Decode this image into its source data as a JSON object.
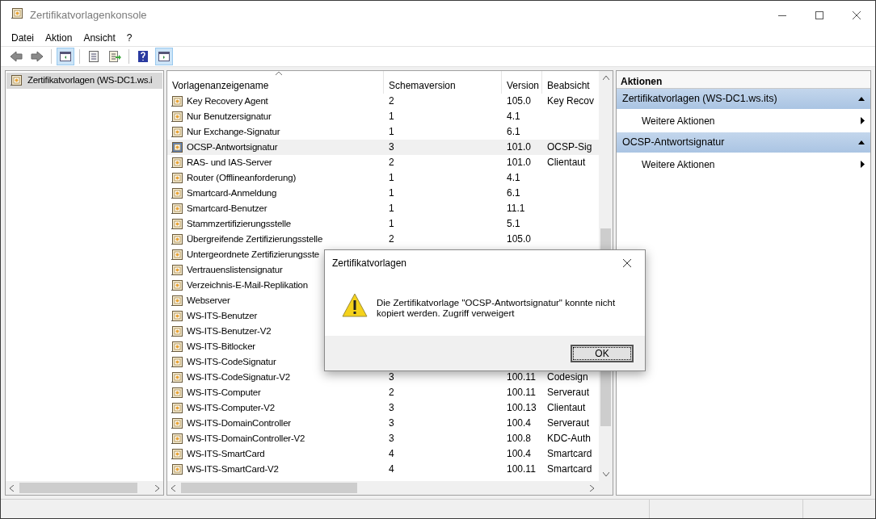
{
  "window": {
    "title": "Zertifikatvorlagenkonsole"
  },
  "menu": [
    "Datei",
    "Aktion",
    "Ansicht",
    "?"
  ],
  "tree": {
    "items": [
      {
        "label": "Zertifikatvorlagen (WS-DC1.ws.i",
        "selected": true
      }
    ]
  },
  "table": {
    "columns": [
      "Vorlagenanzeigename",
      "Schemaversion",
      "Version",
      "Beabsicht"
    ],
    "rows": [
      {
        "name": "Key Recovery Agent",
        "schema": "2",
        "version": "105.0",
        "purpose": "Key Recov",
        "selected": false
      },
      {
        "name": "Nur Benutzersignatur",
        "schema": "1",
        "version": "4.1",
        "selected": false
      },
      {
        "name": "Nur Exchange-Signatur",
        "schema": "1",
        "version": "6.1",
        "selected": false
      },
      {
        "name": "OCSP-Antwortsignatur",
        "schema": "3",
        "version": "101.0",
        "purpose": "OCSP-Sig",
        "selected": true
      },
      {
        "name": "RAS- und IAS-Server",
        "schema": "2",
        "version": "101.0",
        "purpose": "Clientaut",
        "selected": false
      },
      {
        "name": "Router (Offlineanforderung)",
        "schema": "1",
        "version": "4.1",
        "selected": false
      },
      {
        "name": "Smartcard-Anmeldung",
        "schema": "1",
        "version": "6.1",
        "selected": false
      },
      {
        "name": "Smartcard-Benutzer",
        "schema": "1",
        "version": "11.1",
        "selected": false
      },
      {
        "name": "Stammzertifizierungsstelle",
        "schema": "1",
        "version": "5.1",
        "selected": false
      },
      {
        "name": "Übergreifende Zertifizierungsstelle",
        "schema": "2",
        "version": "105.0",
        "selected": false
      },
      {
        "name": "Untergeordnete Zertifizierungsste",
        "selected": false
      },
      {
        "name": "Vertrauenslistensignatur",
        "selected": false
      },
      {
        "name": "Verzeichnis-E-Mail-Replikation",
        "selected": false
      },
      {
        "name": "Webserver",
        "selected": false
      },
      {
        "name": "WS-ITS-Benutzer",
        "selected": false
      },
      {
        "name": "WS-ITS-Benutzer-V2",
        "selected": false
      },
      {
        "name": "WS-ITS-Bitlocker",
        "selected": false
      },
      {
        "name": "WS-ITS-CodeSignatur",
        "selected": false
      },
      {
        "name": "WS-ITS-CodeSignatur-V2",
        "schema": "3",
        "version": "100.11",
        "purpose": "Codesign",
        "selected": false
      },
      {
        "name": "WS-ITS-Computer",
        "schema": "2",
        "version": "100.11",
        "purpose": "Serveraut",
        "selected": false
      },
      {
        "name": "WS-ITS-Computer-V2",
        "schema": "3",
        "version": "100.13",
        "purpose": "Clientaut",
        "selected": false
      },
      {
        "name": "WS-ITS-DomainController",
        "schema": "3",
        "version": "100.4",
        "purpose": "Serveraut",
        "selected": false
      },
      {
        "name": "WS-ITS-DomainController-V2",
        "schema": "3",
        "version": "100.8",
        "purpose": "KDC-Auth",
        "selected": false
      },
      {
        "name": "WS-ITS-SmartCard",
        "schema": "4",
        "version": "100.4",
        "purpose": "Smartcard",
        "selected": false
      },
      {
        "name": "WS-ITS-SmartCard-V2",
        "schema": "4",
        "version": "100.11",
        "purpose": "Smartcard",
        "selected": false
      }
    ]
  },
  "actions": {
    "title": "Aktionen",
    "groups": [
      {
        "label": "Zertifikatvorlagen (WS-DC1.ws.its)",
        "items": [
          "Weitere Aktionen"
        ]
      },
      {
        "label": "OCSP-Antwortsignatur",
        "items": [
          "Weitere Aktionen"
        ]
      }
    ]
  },
  "dialog": {
    "title": "Zertifikatvorlagen",
    "message": "Die Zertifikatvorlage \"OCSP-Antwortsignatur\" konnte nicht kopiert werden. Zugriff verweigert",
    "buttons": [
      "OK"
    ]
  }
}
